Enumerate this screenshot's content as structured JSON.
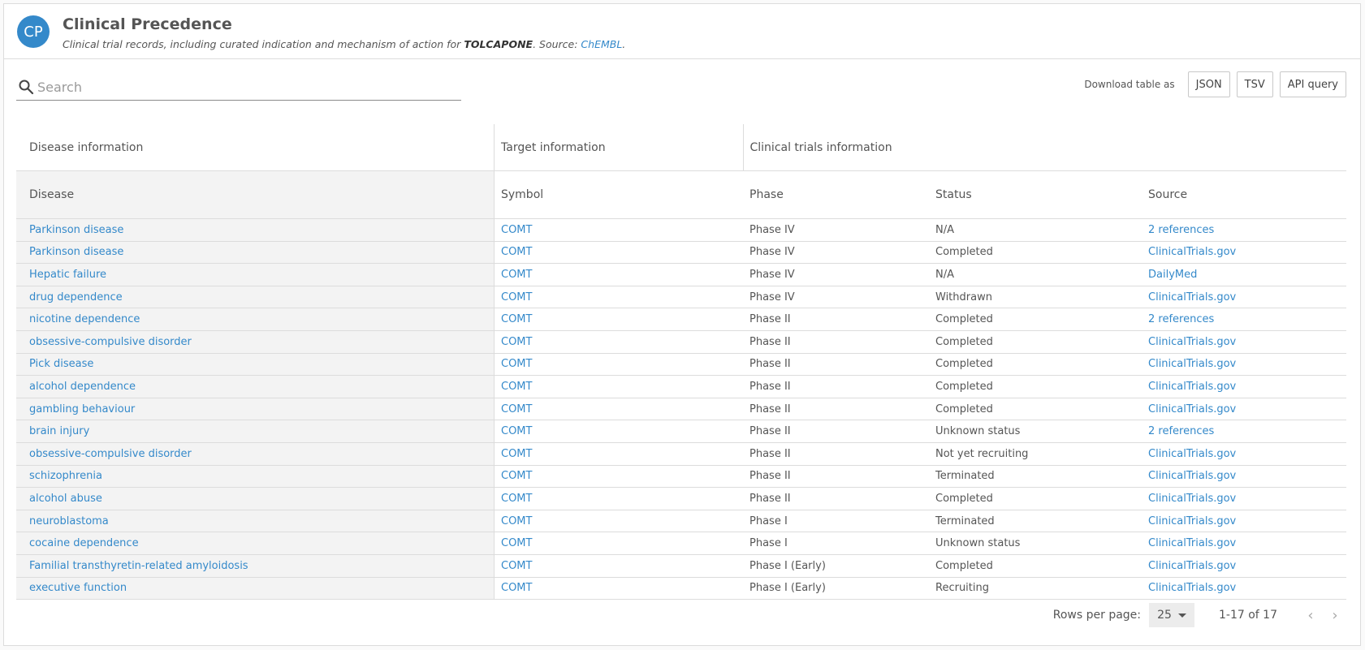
{
  "header": {
    "avatar": "CP",
    "title": "Clinical Precedence",
    "subtitle_prefix": "Clinical trial records, including curated indication and mechanism of action for ",
    "drug": "TOLCAPONE",
    "subtitle_source_prefix": ". Source: ",
    "source_link": "ChEMBL",
    "subtitle_suffix": "."
  },
  "search": {
    "placeholder": "Search",
    "value": ""
  },
  "download": {
    "label": "Download table as",
    "buttons": [
      "JSON",
      "TSV",
      "API query"
    ]
  },
  "table": {
    "groups": [
      "Disease information",
      "Target information",
      "Clinical trials information"
    ],
    "columns": [
      "Disease",
      "Symbol",
      "Phase",
      "Status",
      "Source"
    ],
    "rows": [
      [
        "Parkinson disease",
        "COMT",
        "Phase IV",
        "N/A",
        "2 references"
      ],
      [
        "Parkinson disease",
        "COMT",
        "Phase IV",
        "Completed",
        "ClinicalTrials.gov"
      ],
      [
        "Hepatic failure",
        "COMT",
        "Phase IV",
        "N/A",
        "DailyMed"
      ],
      [
        "drug dependence",
        "COMT",
        "Phase IV",
        "Withdrawn",
        "ClinicalTrials.gov"
      ],
      [
        "nicotine dependence",
        "COMT",
        "Phase II",
        "Completed",
        "2 references"
      ],
      [
        "obsessive-compulsive disorder",
        "COMT",
        "Phase II",
        "Completed",
        "ClinicalTrials.gov"
      ],
      [
        "Pick disease",
        "COMT",
        "Phase II",
        "Completed",
        "ClinicalTrials.gov"
      ],
      [
        "alcohol dependence",
        "COMT",
        "Phase II",
        "Completed",
        "ClinicalTrials.gov"
      ],
      [
        "gambling behaviour",
        "COMT",
        "Phase II",
        "Completed",
        "ClinicalTrials.gov"
      ],
      [
        "brain injury",
        "COMT",
        "Phase II",
        "Unknown status",
        "2 references"
      ],
      [
        "obsessive-compulsive disorder",
        "COMT",
        "Phase II",
        "Not yet recruiting",
        "ClinicalTrials.gov"
      ],
      [
        "schizophrenia",
        "COMT",
        "Phase II",
        "Terminated",
        "ClinicalTrials.gov"
      ],
      [
        "alcohol abuse",
        "COMT",
        "Phase II",
        "Completed",
        "ClinicalTrials.gov"
      ],
      [
        "neuroblastoma",
        "COMT",
        "Phase I",
        "Terminated",
        "ClinicalTrials.gov"
      ],
      [
        "cocaine dependence",
        "COMT",
        "Phase I",
        "Unknown status",
        "ClinicalTrials.gov"
      ],
      [
        "Familial transthyretin-related amyloidosis",
        "COMT",
        "Phase I (Early)",
        "Completed",
        "ClinicalTrials.gov"
      ],
      [
        "executive function",
        "COMT",
        "Phase I (Early)",
        "Recruiting",
        "ClinicalTrials.gov"
      ]
    ]
  },
  "pagination": {
    "rows_per_page_label": "Rows per page:",
    "rows_per_page": "25",
    "range": "1-17 of 17",
    "prev_icon": "‹",
    "next_icon": "›"
  },
  "colors": {
    "accent": "#3489ca",
    "border": "#dcdcdc",
    "shade": "#f3f3f3"
  }
}
